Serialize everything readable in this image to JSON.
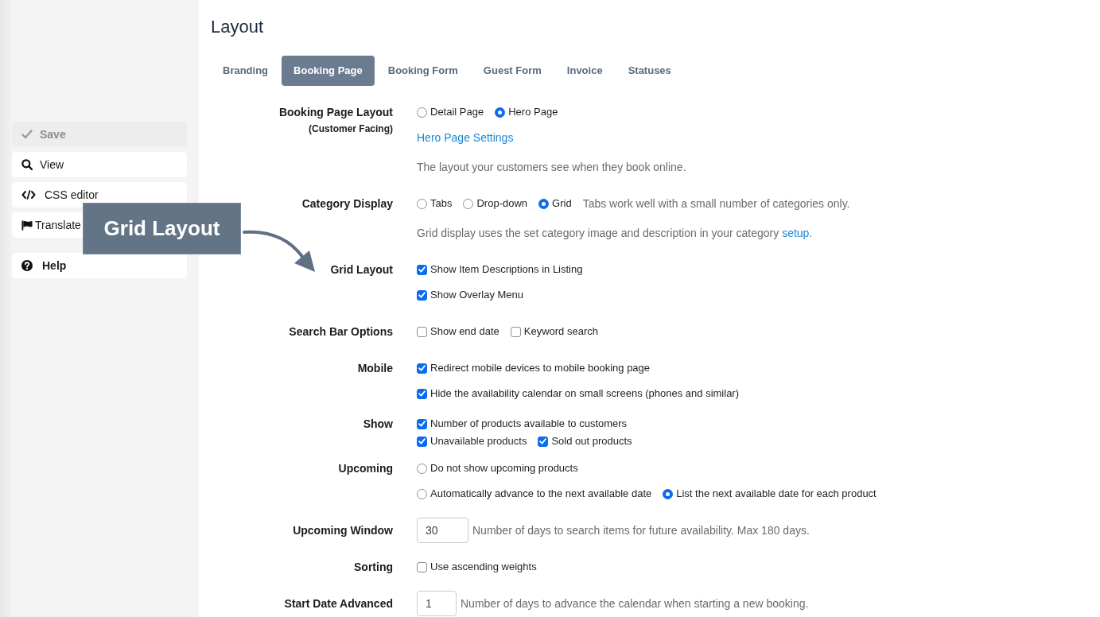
{
  "sidebar": {
    "groups": [
      {
        "items": [
          {
            "kind": "save",
            "label": "Save",
            "disabled": true
          },
          {
            "kind": "view",
            "label": "View",
            "disabled": false
          },
          {
            "kind": "code",
            "label": "CSS editor",
            "disabled": false
          },
          {
            "kind": "translate",
            "label": "Translate",
            "disabled": false
          }
        ]
      },
      {
        "items": [
          {
            "kind": "help",
            "label": "Help",
            "disabled": false
          }
        ]
      }
    ]
  },
  "page_title": "Layout",
  "tabs": [
    {
      "label": "Branding",
      "selected": false
    },
    {
      "label": "Booking Page",
      "selected": true
    },
    {
      "label": "Booking Form",
      "selected": false
    },
    {
      "label": "Guest Form",
      "selected": false
    },
    {
      "label": "Invoice",
      "selected": false
    },
    {
      "label": "Statuses",
      "selected": false
    }
  ],
  "form": {
    "rows": [
      {
        "kind": "field",
        "label": "Booking Page Layout",
        "sublabel": "(Customer Facing)",
        "lines": [
          {
            "kind": "options",
            "items": [
              {
                "kind": "radio",
                "label": "Detail Page",
                "selected": false
              },
              {
                "kind": "radio",
                "label": "Hero Page",
                "selected": true
              }
            ]
          },
          {
            "kind": "link",
            "text": "Hero Page Settings"
          },
          {
            "kind": "note",
            "parts": [
              {
                "kind": "text",
                "text": "The layout your customers see when they book online."
              }
            ]
          }
        ]
      },
      {
        "kind": "field",
        "label": "Category Display",
        "lines": [
          {
            "kind": "options",
            "items": [
              {
                "kind": "radio",
                "label": "Tabs",
                "selected": false
              },
              {
                "kind": "radio",
                "label": "Drop-down",
                "selected": false
              },
              {
                "kind": "radio",
                "label": "Grid",
                "selected": true
              },
              {
                "kind": "hint",
                "text": "Tabs work well with a small number of categories only."
              }
            ]
          },
          {
            "kind": "note",
            "parts": [
              {
                "kind": "text",
                "text": "Grid display uses the set category image and description in your category "
              },
              {
                "kind": "link",
                "text": "setup"
              },
              {
                "kind": "text",
                "text": "."
              }
            ]
          }
        ]
      },
      {
        "kind": "field",
        "label": "Grid Layout",
        "lines": [
          {
            "kind": "options",
            "items": [
              {
                "kind": "checkbox",
                "label": "Show Item Descriptions in Listing",
                "checked": true
              }
            ]
          },
          {
            "kind": "options",
            "items": [
              {
                "kind": "checkbox",
                "label": "Show Overlay Menu",
                "checked": true
              }
            ]
          }
        ]
      },
      {
        "kind": "field",
        "label": "Search Bar Options",
        "lines": [
          {
            "kind": "options",
            "items": [
              {
                "kind": "checkbox",
                "label": "Show end date",
                "checked": false
              },
              {
                "kind": "checkbox",
                "label": "Keyword search",
                "checked": false
              }
            ]
          }
        ]
      },
      {
        "kind": "field",
        "label": "Mobile",
        "lines": [
          {
            "kind": "options",
            "items": [
              {
                "kind": "checkbox",
                "label": "Redirect mobile devices to mobile booking page",
                "checked": true
              }
            ]
          },
          {
            "kind": "options",
            "items": [
              {
                "kind": "checkbox",
                "label": "Hide the availability calendar on small screens (phones and similar)",
                "checked": true
              }
            ]
          }
        ]
      },
      {
        "kind": "checklist",
        "label": "Show",
        "lines": [
          {
            "kind": "options",
            "items": [
              {
                "kind": "checkbox",
                "label": "Number of products available to customers",
                "checked": true
              }
            ]
          },
          {
            "kind": "options",
            "items": [
              {
                "kind": "checkbox",
                "label": "Unavailable products",
                "checked": true
              },
              {
                "kind": "checkbox",
                "label": "Sold out products",
                "checked": true
              }
            ]
          }
        ]
      },
      {
        "kind": "field",
        "label": "Upcoming",
        "lines": [
          {
            "kind": "options",
            "items": [
              {
                "kind": "radio",
                "label": "Do not show upcoming products",
                "selected": false
              }
            ]
          },
          {
            "kind": "options",
            "items": [
              {
                "kind": "radio",
                "label": "Automatically advance to the next available date",
                "selected": false
              },
              {
                "kind": "radio",
                "label": "List the next available date for each product",
                "selected": true
              }
            ]
          }
        ]
      },
      {
        "kind": "field",
        "label": "Upcoming Window",
        "lines": [
          {
            "kind": "options",
            "items": [
              {
                "kind": "input",
                "value": "30"
              },
              {
                "kind": "hint",
                "text": "Number of days to search items for future availability. Max 180 days."
              }
            ]
          }
        ]
      },
      {
        "kind": "field",
        "label": "Sorting",
        "lines": [
          {
            "kind": "options",
            "items": [
              {
                "kind": "checkbox",
                "label": "Use ascending weights",
                "checked": false
              }
            ]
          }
        ]
      },
      {
        "kind": "field",
        "label": "Start Date Advanced",
        "lines": [
          {
            "kind": "options",
            "items": [
              {
                "kind": "input",
                "value": "1"
              },
              {
                "kind": "hint",
                "text": "Number of days to advance the calendar when starting a new booking."
              }
            ]
          }
        ]
      }
    ]
  },
  "callout": {
    "text": "Grid Layout"
  }
}
